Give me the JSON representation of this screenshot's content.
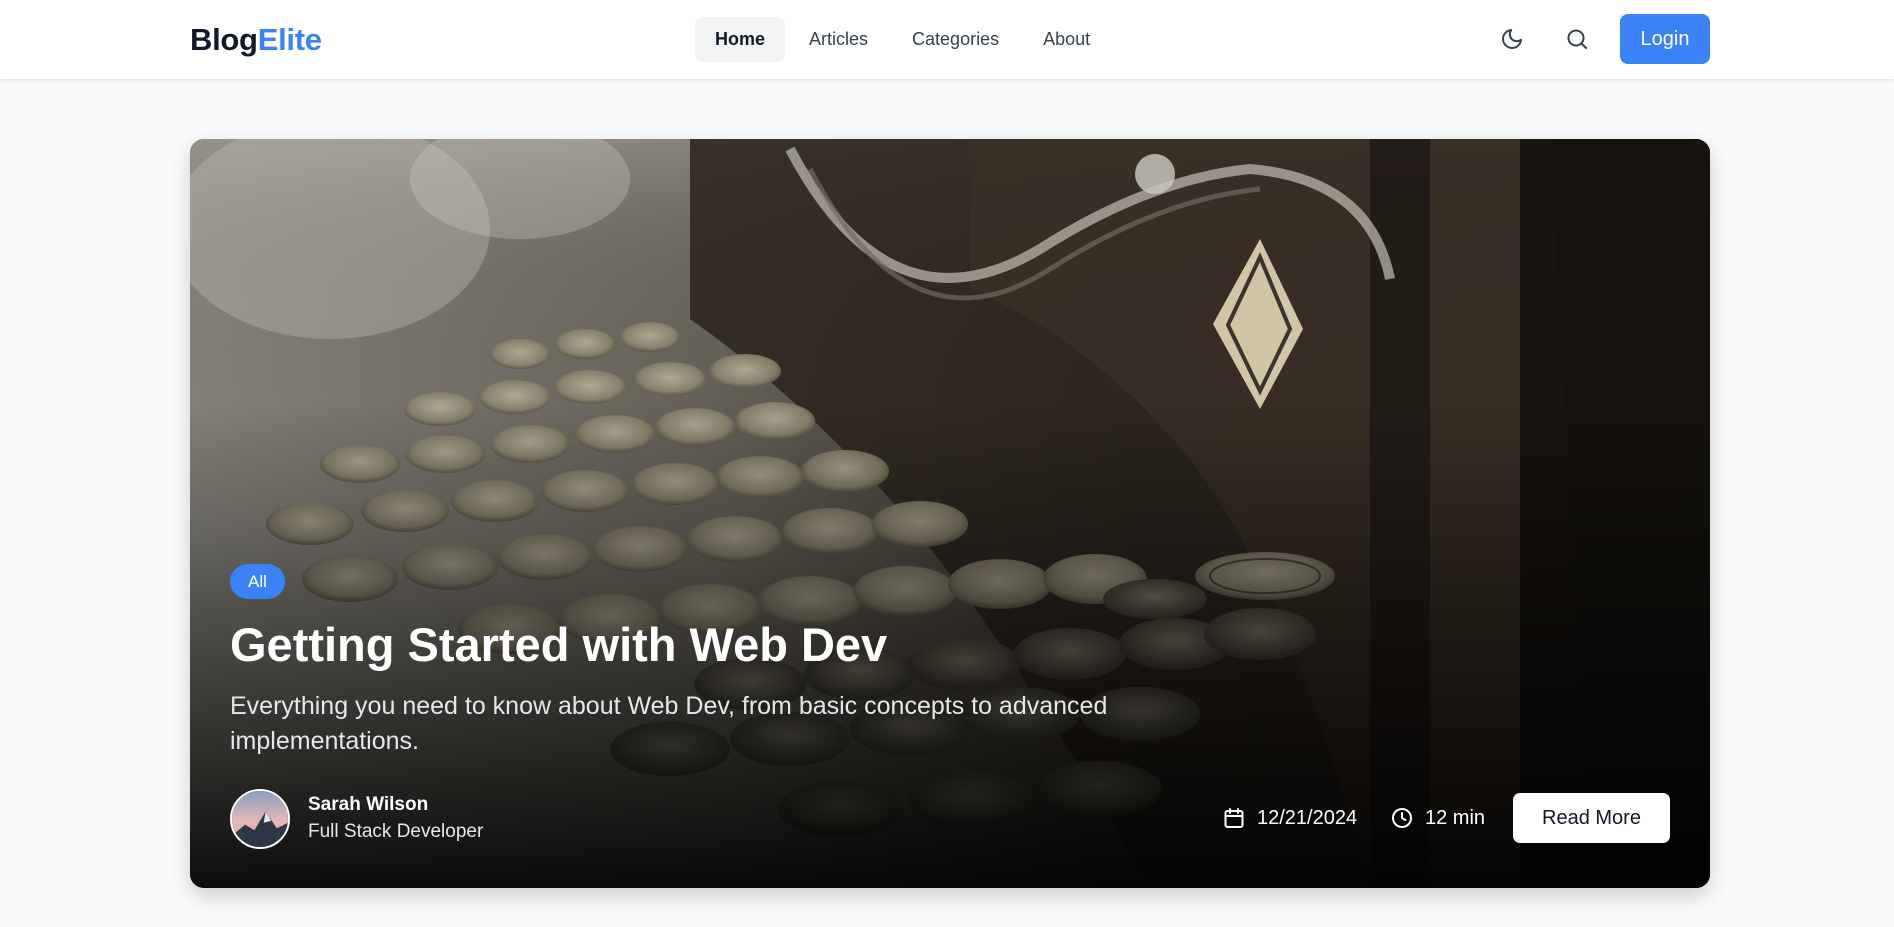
{
  "header": {
    "logo": {
      "part1": "Blog",
      "part2": "Elite"
    },
    "nav": [
      {
        "label": "Home",
        "active": true
      },
      {
        "label": "Articles",
        "active": false
      },
      {
        "label": "Categories",
        "active": false
      },
      {
        "label": "About",
        "active": false
      }
    ],
    "icons": {
      "theme_toggle": "moon-icon",
      "search": "search-icon"
    },
    "login_label": "Login"
  },
  "hero": {
    "category": "All",
    "title": "Getting Started with Web Dev",
    "description": "Everything you need to know about Web Dev, from basic concepts to advanced implementations.",
    "author": {
      "name": "Sarah Wilson",
      "role": "Full Stack Developer"
    },
    "date": "12/21/2024",
    "read_time": "12 min",
    "read_more_label": "Read More",
    "image": "vintage-typewriter-photo"
  },
  "colors": {
    "accent": "#3b82f6",
    "page_background": "#f8fafc",
    "header_background": "#ffffff"
  }
}
